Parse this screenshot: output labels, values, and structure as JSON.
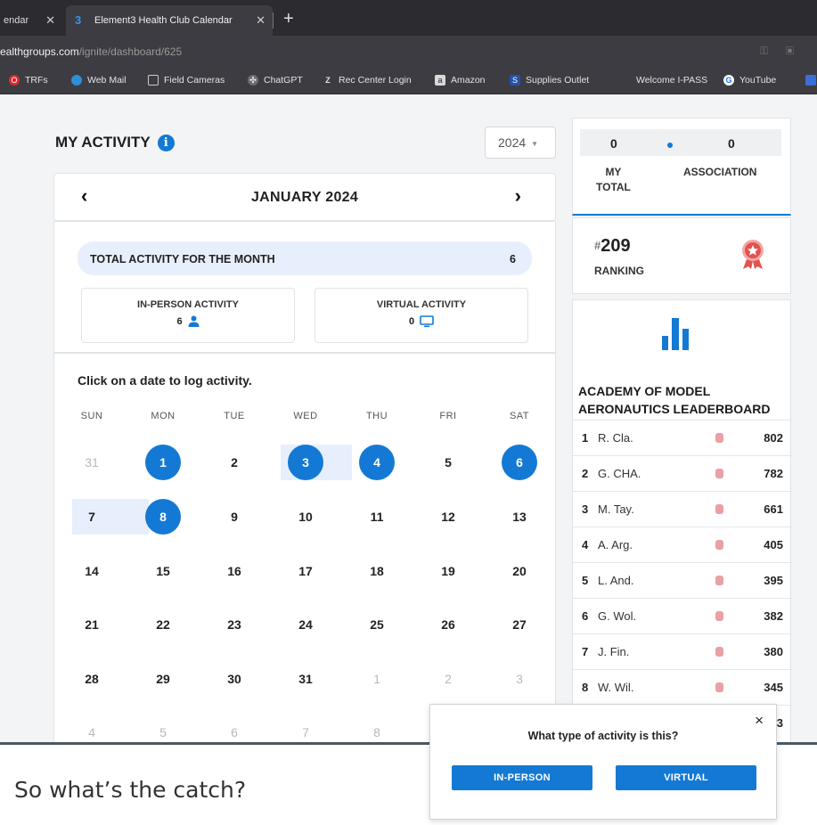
{
  "browser": {
    "tabs": [
      {
        "label": "endar",
        "active": false
      },
      {
        "label": "Element3 Health Club Calendar",
        "active": true
      }
    ],
    "url_host": "ealthgroups.com",
    "url_path": "/ignite/dashboard/625",
    "bookmarks": [
      {
        "label": "TRFs",
        "icon": "opera-icon"
      },
      {
        "label": "Web Mail",
        "icon": "globe-icon"
      },
      {
        "label": "Field Cameras",
        "icon": "page-icon"
      },
      {
        "label": "ChatGPT",
        "icon": "chatgpt-icon"
      },
      {
        "label": "Rec Center Login",
        "icon": "rec-icon"
      },
      {
        "label": "Amazon",
        "icon": "amazon-icon"
      },
      {
        "label": "Supplies Outlet",
        "icon": "supplies-icon"
      },
      {
        "label": "Welcome I-PASS",
        "icon": "ipass-icon"
      },
      {
        "label": "YouTube",
        "icon": "google-icon"
      }
    ]
  },
  "activity": {
    "heading": "MY ACTIVITY",
    "year": "2024",
    "month": "JANUARY 2024",
    "total_label": "TOTAL ACTIVITY FOR THE MONTH",
    "total_value": "6",
    "in_person_label": "IN-PERSON ACTIVITY",
    "in_person_value": "6",
    "virtual_label": "VIRTUAL ACTIVITY",
    "virtual_value": "0"
  },
  "calendar": {
    "hint": "Click on a date to log activity.",
    "weekdays": [
      "SUN",
      "MON",
      "TUE",
      "WED",
      "THU",
      "FRI",
      "SAT"
    ],
    "weeks": [
      [
        {
          "d": "31",
          "o": true
        },
        {
          "d": "1",
          "l": true
        },
        {
          "d": "2"
        },
        {
          "d": "3",
          "l": true
        },
        {
          "d": "4",
          "l": true
        },
        {
          "d": "5"
        },
        {
          "d": "6",
          "l": true
        }
      ],
      [
        {
          "d": "7"
        },
        {
          "d": "8",
          "l": true
        },
        {
          "d": "9"
        },
        {
          "d": "10"
        },
        {
          "d": "11"
        },
        {
          "d": "12"
        },
        {
          "d": "13"
        }
      ],
      [
        {
          "d": "14"
        },
        {
          "d": "15"
        },
        {
          "d": "16"
        },
        {
          "d": "17"
        },
        {
          "d": "18"
        },
        {
          "d": "19"
        },
        {
          "d": "20"
        }
      ],
      [
        {
          "d": "21"
        },
        {
          "d": "22"
        },
        {
          "d": "23"
        },
        {
          "d": "24"
        },
        {
          "d": "25"
        },
        {
          "d": "26"
        },
        {
          "d": "27"
        }
      ],
      [
        {
          "d": "28"
        },
        {
          "d": "29"
        },
        {
          "d": "30"
        },
        {
          "d": "31"
        },
        {
          "d": "1",
          "o": true
        },
        {
          "d": "2",
          "o": true
        },
        {
          "d": "3",
          "o": true
        }
      ],
      [
        {
          "d": "4",
          "o": true
        },
        {
          "d": "5",
          "o": true
        },
        {
          "d": "6",
          "o": true
        },
        {
          "d": "7",
          "o": true
        },
        {
          "d": "8",
          "o": true
        },
        {
          "d": "",
          "o": true
        },
        {
          "d": "",
          "o": true
        }
      ]
    ]
  },
  "totals": {
    "my_total": "0",
    "association": "0",
    "my_total_label_1": "MY",
    "my_total_label_2": "TOTAL",
    "association_label": "ASSOCIATION"
  },
  "ranking": {
    "hash": "#",
    "number": "209",
    "label": "RANKING"
  },
  "leaderboard": {
    "title": "ACADEMY OF MODEL AERONAUTICS LEADERBOARD",
    "rows": [
      {
        "rank": "1",
        "name": "R. Cla.",
        "score": "802"
      },
      {
        "rank": "2",
        "name": "G. CHA.",
        "score": "782"
      },
      {
        "rank": "3",
        "name": "M. Tay.",
        "score": "661"
      },
      {
        "rank": "4",
        "name": "A. Arg.",
        "score": "405"
      },
      {
        "rank": "5",
        "name": "L. And.",
        "score": "395"
      },
      {
        "rank": "6",
        "name": "G. Wol.",
        "score": "382"
      },
      {
        "rank": "7",
        "name": "J. Fin.",
        "score": "380"
      },
      {
        "rank": "8",
        "name": "W. Wil.",
        "score": "345"
      },
      {
        "rank": "",
        "name": "",
        "score": "3"
      }
    ]
  },
  "dialog": {
    "title": "What type of activity is this?",
    "close": "×",
    "in_person": "IN-PERSON",
    "virtual": "VIRTUAL"
  },
  "caption": "So what’s the catch?",
  "colors": {
    "accent": "#1479d4",
    "highlight": "#e8effc",
    "badge": "#e9a0a6"
  }
}
